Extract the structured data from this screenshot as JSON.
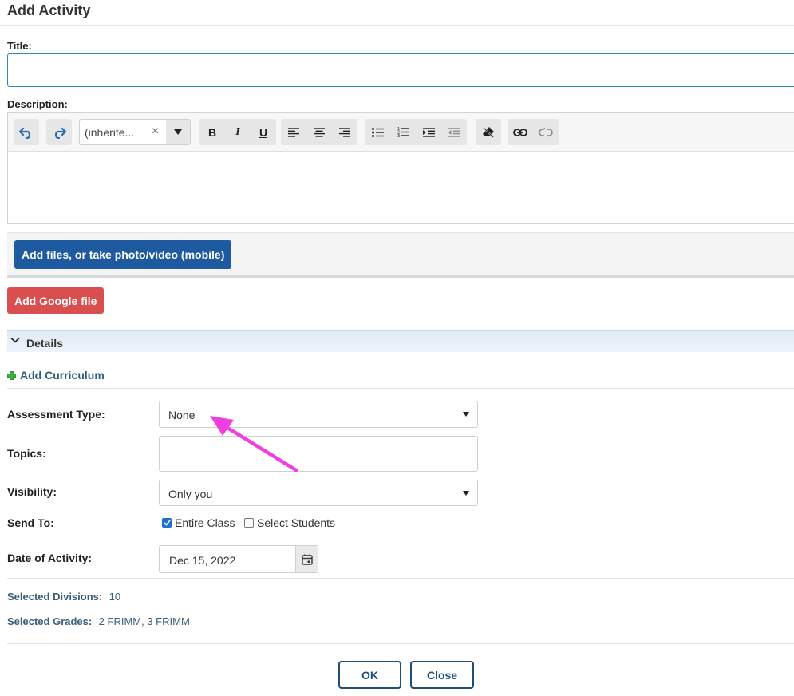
{
  "dialog": {
    "title": "Add Activity"
  },
  "form": {
    "title_label": "Title:",
    "title_value": "",
    "description_label": "Description:"
  },
  "editor": {
    "font_value": "(inherite...",
    "font_clear": "×"
  },
  "attachments": {
    "upload_label": "Add files, or take photo/video (mobile)",
    "google_label": "Add Google file"
  },
  "details": {
    "section_label": "Details",
    "add_curriculum": "Add Curriculum",
    "assessment_label": "Assessment Type:",
    "assessment_value": "None",
    "topics_label": "Topics:",
    "visibility_label": "Visibility:",
    "visibility_value": "Only you",
    "send_to_label": "Send To:",
    "send_options": [
      {
        "label": "Entire Class",
        "checked": true
      },
      {
        "label": "Select Students",
        "checked": false
      }
    ],
    "date_label": "Date of Activity:",
    "date_value": "Dec 15, 2022",
    "divisions_label": "Selected Divisions:",
    "divisions_value": "10",
    "grades_label": "Selected Grades:",
    "grades_value": "2 FRIMM, 3 FRIMM"
  },
  "actions": {
    "ok": "OK",
    "close": "Close"
  },
  "colors": {
    "primary": "#1d5aa0",
    "google": "#d94f4f",
    "annotation_arrow": "#f03fe0",
    "link": "#2c5f7c"
  }
}
